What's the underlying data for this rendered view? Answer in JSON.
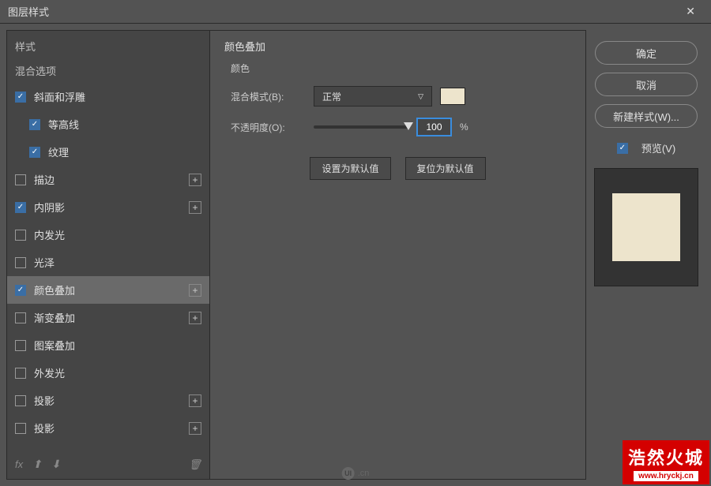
{
  "titlebar": {
    "title": "图层样式",
    "close": "✕"
  },
  "sidebar": {
    "styles_label": "样式",
    "blend_label": "混合选项",
    "items": [
      {
        "label": "斜面和浮雕",
        "checked": true,
        "indent": false,
        "plus": false
      },
      {
        "label": "等高线",
        "checked": true,
        "indent": true,
        "plus": false
      },
      {
        "label": "纹理",
        "checked": true,
        "indent": true,
        "plus": false
      },
      {
        "label": "描边",
        "checked": false,
        "indent": false,
        "plus": true
      },
      {
        "label": "内阴影",
        "checked": true,
        "indent": false,
        "plus": true
      },
      {
        "label": "内发光",
        "checked": false,
        "indent": false,
        "plus": false
      },
      {
        "label": "光泽",
        "checked": false,
        "indent": false,
        "plus": false
      },
      {
        "label": "颜色叠加",
        "checked": true,
        "indent": false,
        "plus": true,
        "selected": true
      },
      {
        "label": "渐变叠加",
        "checked": false,
        "indent": false,
        "plus": true
      },
      {
        "label": "图案叠加",
        "checked": false,
        "indent": false,
        "plus": false
      },
      {
        "label": "外发光",
        "checked": false,
        "indent": false,
        "plus": false
      },
      {
        "label": "投影",
        "checked": false,
        "indent": false,
        "plus": true
      },
      {
        "label": "投影",
        "checked": false,
        "indent": false,
        "plus": true
      }
    ],
    "fx_label": "fx"
  },
  "main": {
    "section_title": "颜色叠加",
    "section_sub": "颜色",
    "blend_mode_label": "混合模式(B):",
    "blend_mode_value": "正常",
    "opacity_label": "不透明度(O):",
    "opacity_value": "100",
    "percent": "%",
    "set_default": "设置为默认值",
    "reset_default": "复位为默认值",
    "swatch_color": "#ede4cc"
  },
  "right": {
    "ok": "确定",
    "cancel": "取消",
    "new_style": "新建样式(W)...",
    "preview": "预览(V)"
  },
  "watermark": {
    "ui_text": ".cn",
    "logo_text1": "浩然火城",
    "logo_text2": "www.hryckj.cn"
  }
}
